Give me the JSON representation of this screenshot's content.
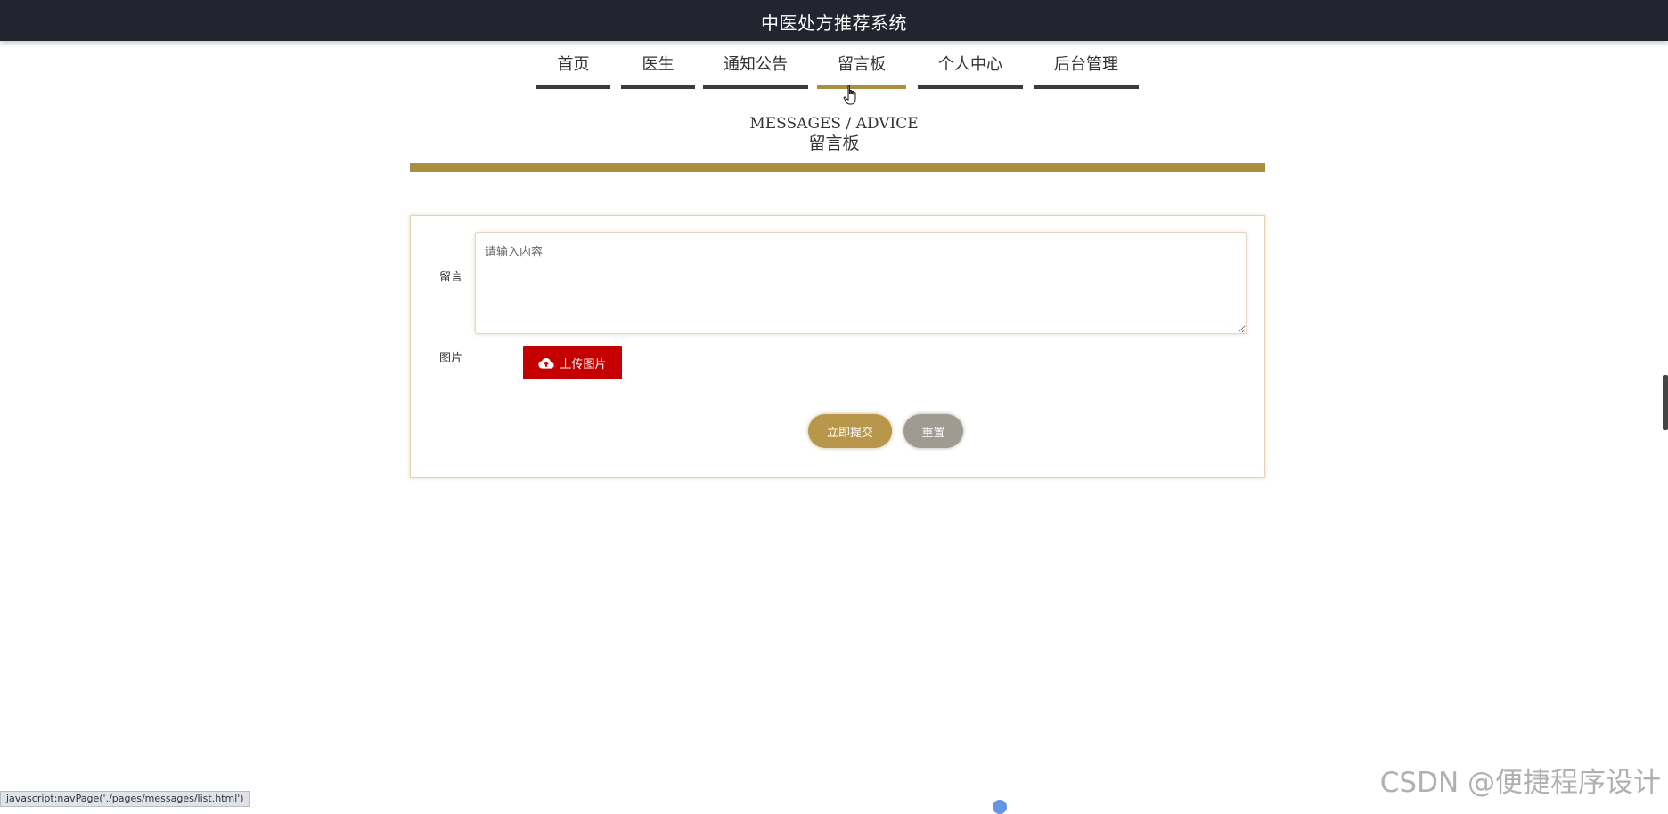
{
  "header": {
    "title": "中医处方推荐系统"
  },
  "nav": {
    "items": [
      {
        "label": "首页"
      },
      {
        "label": "医生"
      },
      {
        "label": "通知公告"
      },
      {
        "label": "留言板"
      },
      {
        "label": "个人中心"
      },
      {
        "label": "后台管理"
      }
    ],
    "active_index": 3
  },
  "section": {
    "title_en": "MESSAGES / ADVICE",
    "title_cn": "留言板"
  },
  "form": {
    "message_label": "留言",
    "message_placeholder": "请输入内容",
    "message_value": "",
    "image_label": "图片",
    "upload_label": "上传图片",
    "upload_icon": "cloud-upload-icon",
    "submit_label": "立即提交",
    "reset_label": "重置"
  },
  "status_bar": {
    "url": "javascript:navPage('./pages/messages/list.html')"
  },
  "watermark": {
    "text": "CSDN @便捷程序设计"
  },
  "colors": {
    "topbar": "#22252f",
    "accent_gold": "#a98f3f",
    "nav_bar": "#3a3a3a",
    "upload_red": "#c40000",
    "submit_gold": "#b9974a",
    "reset_gray": "#a09a90"
  }
}
